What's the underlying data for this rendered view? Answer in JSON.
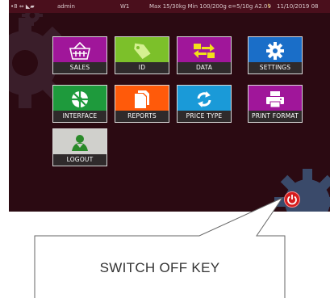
{
  "status_bar": {
    "indicators": "•8  ⇔  ◣▰",
    "user": "admin",
    "scale": "W1",
    "range": "Max 15/30kg  Min 100/200g  e=5/10g A2.09",
    "datetime": "11/10/2019 08"
  },
  "menu": {
    "sales": "SALES",
    "id": "ID",
    "data": "DATA",
    "settings": "SETTINGS",
    "interface": "INTERFACE",
    "reports": "REPORTS",
    "price_type": "PRICE TYPE",
    "print_format": "PRINT FORMAT",
    "logout": "LOGOUT"
  },
  "callout": {
    "label": "SWITCH OFF KEY"
  },
  "colors": {
    "background": "#2b0a12",
    "status_bar": "#4a0f1c",
    "sales": "#a0169a",
    "id": "#7cc02a",
    "data": "#a0169a",
    "settings": "#1a6ec8",
    "interface": "#1e9a3c",
    "reports": "#ff5a0a",
    "price_type": "#1a9ad8",
    "print_format": "#a0169a",
    "logout": "#d0d0cc",
    "power": "#d51c1c"
  },
  "icons": {
    "sales": "basket-icon",
    "id": "tag-icon",
    "data": "transfer-arrows-icon",
    "settings": "gear-icon",
    "interface": "network-icon",
    "reports": "documents-icon",
    "price_type": "refresh-icon",
    "print_format": "printer-icon",
    "logout": "user-icon",
    "power": "power-icon"
  }
}
